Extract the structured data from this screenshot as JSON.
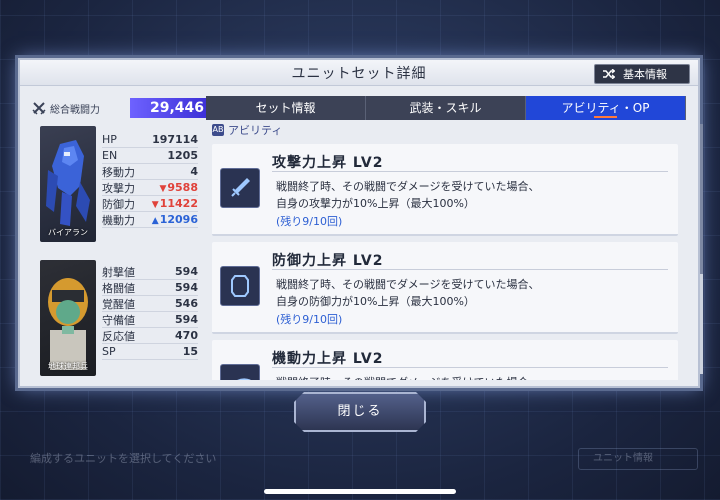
{
  "modal": {
    "title": "ユニットセット詳細",
    "basic_info_label": "基本情報",
    "close_label": "閉じる"
  },
  "power": {
    "label": "総合戦闘力",
    "value": "29,446"
  },
  "unit": {
    "name": "バイアラン",
    "stats": [
      {
        "label": "HP",
        "value": "197114"
      },
      {
        "label": "EN",
        "value": "1205"
      },
      {
        "label": "移動力",
        "value": "4"
      },
      {
        "label": "攻撃力",
        "value": "9588",
        "trend": "down"
      },
      {
        "label": "防御力",
        "value": "11422",
        "trend": "down"
      },
      {
        "label": "機動力",
        "value": "12096",
        "trend": "up"
      }
    ]
  },
  "pilot": {
    "name": "地球連邦兵",
    "stats": [
      {
        "label": "射撃値",
        "value": "594"
      },
      {
        "label": "格闘値",
        "value": "594"
      },
      {
        "label": "覚醒値",
        "value": "546"
      },
      {
        "label": "守備値",
        "value": "594"
      },
      {
        "label": "反応値",
        "value": "470"
      },
      {
        "label": "SP",
        "value": "15"
      }
    ]
  },
  "tabs": [
    {
      "label": "セット情報",
      "active": false
    },
    {
      "label": "武装・スキル",
      "active": false
    },
    {
      "label": "アビリティ・OP",
      "active": true
    }
  ],
  "abilities_section": {
    "icon_text": "AB",
    "label": "アビリティ"
  },
  "abilities": [
    {
      "name": "攻撃力上昇 LV2",
      "icon": "sword-icon",
      "desc1": "戦闘終了時、その戦闘でダメージを受けていた場合、",
      "desc2": "自身の攻撃力が10%上昇（最大100%）",
      "remaining": "(残り9/10回)"
    },
    {
      "name": "防御力上昇 LV2",
      "icon": "shield-icon",
      "desc1": "戦闘終了時、その戦闘でダメージを受けていた場合、",
      "desc2": "自身の防御力が10%上昇（最大100%）",
      "remaining": "(残り9/10回)"
    },
    {
      "name": "機動力上昇 LV2",
      "icon": "mobility-icon",
      "desc1": "戦闘終了時、その戦闘でダメージを受けていた場合、",
      "desc2": "",
      "remaining": ""
    }
  ],
  "background": {
    "hint_left": "編成するユニットを選択してください",
    "hint_right": "ユニット情報"
  },
  "colors": {
    "accent": "#2147d8",
    "power_bar": "#5a4ef0",
    "stat_down": "#e0423a",
    "stat_up": "#2a62d6"
  }
}
